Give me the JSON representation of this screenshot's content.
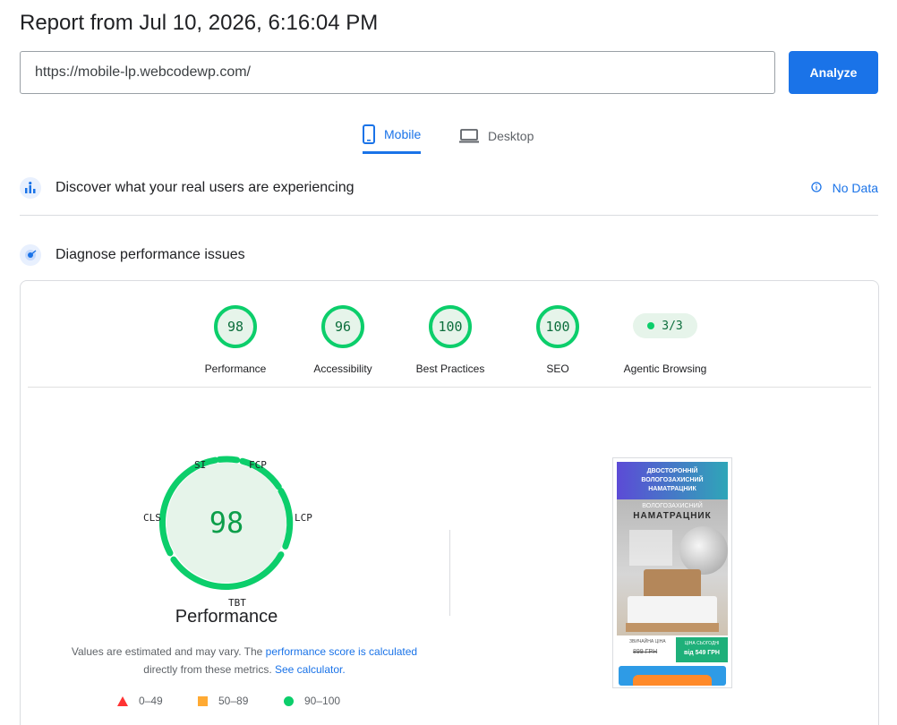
{
  "header": {
    "title": "Report from Jul 10, 2026, 6:16:04 PM",
    "url_value": "https://mobile-lp.webcodewp.com/",
    "analyze_label": "Analyze"
  },
  "tabs": [
    {
      "label": "Mobile",
      "active": true,
      "icon": "phone-icon"
    },
    {
      "label": "Desktop",
      "active": false,
      "icon": "laptop-icon"
    }
  ],
  "field_data": {
    "label": "Discover what your real users are experiencing",
    "status": "No Data",
    "icon": "users-chart-icon"
  },
  "diagnose": {
    "label": "Diagnose performance issues",
    "icon": "lighthouse-icon"
  },
  "scores": [
    {
      "label": "Performance",
      "value": "98"
    },
    {
      "label": "Accessibility",
      "value": "96"
    },
    {
      "label": "Best Practices",
      "value": "100"
    },
    {
      "label": "SEO",
      "value": "100"
    }
  ],
  "agentic": {
    "label": "Agentic Browsing",
    "value": "3/3"
  },
  "performance": {
    "score": "98",
    "title": "Performance",
    "metrics": [
      "SI",
      "FCP",
      "LCP",
      "TBT",
      "CLS"
    ],
    "note_prefix": "Values are estimated and may vary. The ",
    "note_link1": "performance score is calculated",
    "note_middle": " directly from these metrics. ",
    "note_link2": "See calculator."
  },
  "legend": [
    {
      "range": "0–49",
      "shape": "triangle",
      "color": "#ff3333"
    },
    {
      "range": "50–89",
      "shape": "square",
      "color": "#ffaa33"
    },
    {
      "range": "90–100",
      "shape": "circle",
      "color": "#0cce6b"
    }
  ],
  "screenshot": {
    "header_text": "ДВОСТОРОННІЙ ВОЛОГОЗАХИСНИЙ НАМАТРАЦНИК",
    "subtitle": "ВОЛОГОЗАХИСНИЙ",
    "title": "НАМАТРАЦНИК",
    "old_label": "ЗВИЧАЙНА ЦІНА",
    "old_price": "899 ГРН",
    "new_label": "ЦІНА СЬОГОДНІ",
    "new_price": "від 549 ГРН"
  },
  "colors": {
    "accent": "#1a73e8",
    "pass": "#0cce6b",
    "pass_text": "#0c6e3c"
  }
}
